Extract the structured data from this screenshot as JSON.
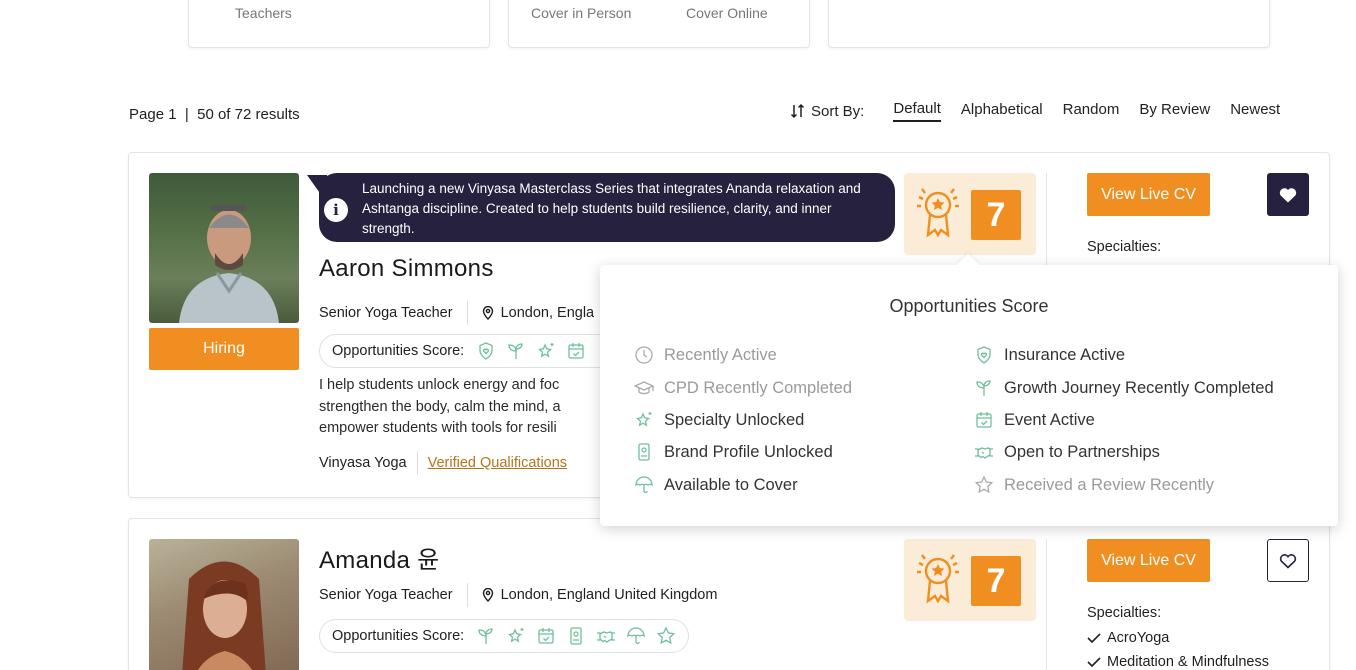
{
  "top_cards": [
    {
      "labels": [
        "Teachers"
      ]
    },
    {
      "labels": [
        "Cover in Person",
        "Cover Online"
      ]
    },
    {
      "labels": []
    }
  ],
  "results": {
    "text": "Page 1  |  50 of 72 results"
  },
  "sort": {
    "label": "Sort By:",
    "options": [
      "Default",
      "Alphabetical",
      "Random",
      "By Review",
      "Newest"
    ],
    "active": "Default"
  },
  "teachers": [
    {
      "announcement": "Launching a new Vinyasa Masterclass Series that integrates Ananda relaxation and Ashtanga discipline. Created to help students build resilience, clarity, and inner strength.",
      "name": "Aaron Simmons",
      "title": "Senior Yoga Teacher",
      "location": "London, Engla",
      "hiring_label": "Hiring",
      "opportunities_label": "Opportunities Score:",
      "bio_lines": [
        "I help students unlock energy and foc",
        "strengthen the body, calm the mind, a",
        "empower students with tools for resili"
      ],
      "style": "Vinyasa Yoga",
      "verified_link": "Verified Qualifications",
      "score": "7",
      "cv_label": "View Live CV",
      "specialties_label": "Specialties:",
      "favorited": true
    },
    {
      "name": "Amanda 윤",
      "title": "Senior Yoga Teacher",
      "location": "London, England United Kingdom",
      "opportunities_label": "Opportunities Score:",
      "score": "7",
      "cv_label": "View Live CV",
      "specialties_label": "Specialties:",
      "specialties": [
        "AcroYoga",
        "Meditation & Mindfulness"
      ],
      "favorited": false
    }
  ],
  "popover": {
    "title": "Opportunities Score",
    "items_left": [
      {
        "label": "Recently Active",
        "icon": "clock-icon",
        "active": false
      },
      {
        "label": "CPD Recently Completed",
        "icon": "graduation-cap-icon",
        "active": false
      },
      {
        "label": "Specialty Unlocked",
        "icon": "sparkle-star-icon",
        "active": true
      },
      {
        "label": "Brand Profile Unlocked",
        "icon": "id-badge-icon",
        "active": true
      },
      {
        "label": "Available to Cover",
        "icon": "umbrella-icon",
        "active": true
      }
    ],
    "items_right": [
      {
        "label": "Insurance Active",
        "icon": "shield-heart-icon",
        "active": true
      },
      {
        "label": "Growth Journey Recently Completed",
        "icon": "sprout-icon",
        "active": true
      },
      {
        "label": "Event Active",
        "icon": "calendar-check-icon",
        "active": true
      },
      {
        "label": "Open to Partnerships",
        "icon": "handshake-icon",
        "active": true
      },
      {
        "label": "Received a Review Recently",
        "icon": "star-icon",
        "active": false
      }
    ]
  },
  "colors": {
    "accent": "#f08e22",
    "navy": "#26213f",
    "icon_green": "#6fbf9a",
    "score_bg": "#fbecd8"
  }
}
